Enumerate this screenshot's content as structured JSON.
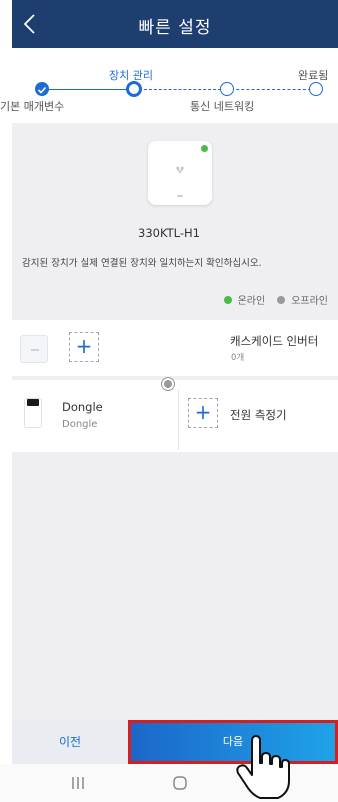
{
  "header": {
    "title": "빠른 설정"
  },
  "stepper": {
    "steps": [
      {
        "label": "기본 매개변수",
        "state": "done"
      },
      {
        "label": "장치 관리",
        "state": "current"
      },
      {
        "label": "통신 네트워킹",
        "state": "pending"
      },
      {
        "label": "완료됨",
        "state": "pending"
      }
    ]
  },
  "device": {
    "model": "330KTL-H1",
    "status": "online",
    "icon": "inverter-icon"
  },
  "notice": "감지된 장치가 실제 연결된 장치와 일치하는지 확인하십시오.",
  "legend": {
    "online": "온라인",
    "offline": "오프라인",
    "online_color": "#4cba48",
    "offline_color": "#9a9a9a"
  },
  "cascade": {
    "title": "캐스케이드 인버터",
    "count": "0개"
  },
  "dongle": {
    "title": "Dongle",
    "subtitle": "Dongle"
  },
  "power_meter": {
    "title": "전원 측정기"
  },
  "footer": {
    "prev_label": "이전",
    "next_label": "다음"
  },
  "colors": {
    "header": "#1d3e6e",
    "accent": "#1e6bd6",
    "highlight_border": "#d71d1d"
  }
}
